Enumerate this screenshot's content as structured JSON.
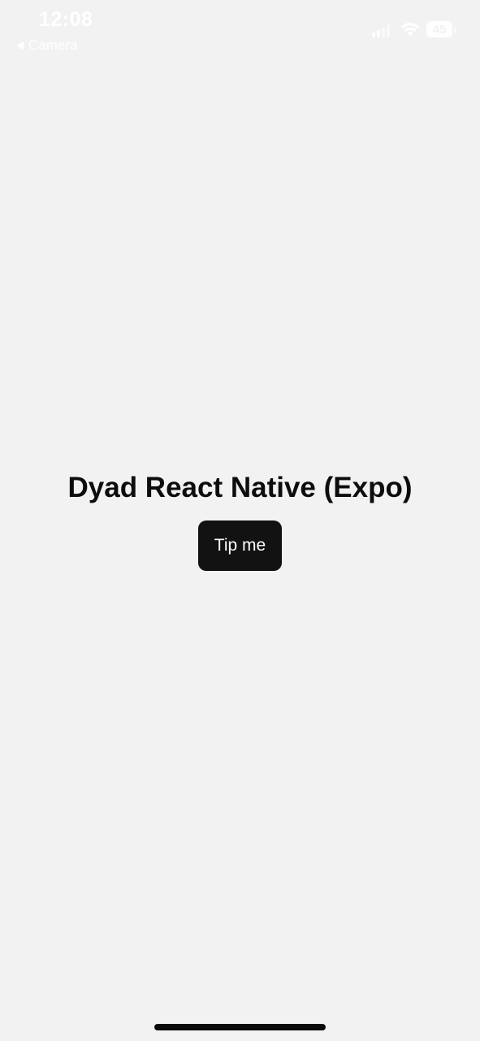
{
  "status_bar": {
    "time": "12:08",
    "back_app_label": "Camera",
    "battery_level": "45",
    "icons": [
      "back-arrow-icon",
      "cellular-signal-icon",
      "wifi-icon",
      "battery-icon"
    ]
  },
  "main": {
    "title": "Dyad React Native (Expo)",
    "tip_button_label": "Tip me"
  },
  "colors": {
    "background": "#f2f2f2",
    "title_text": "#0d0d0d",
    "button_background": "#121212",
    "button_text": "#ffffff",
    "status_bar_text": "#ffffff",
    "home_indicator": "#0a0a0a"
  }
}
